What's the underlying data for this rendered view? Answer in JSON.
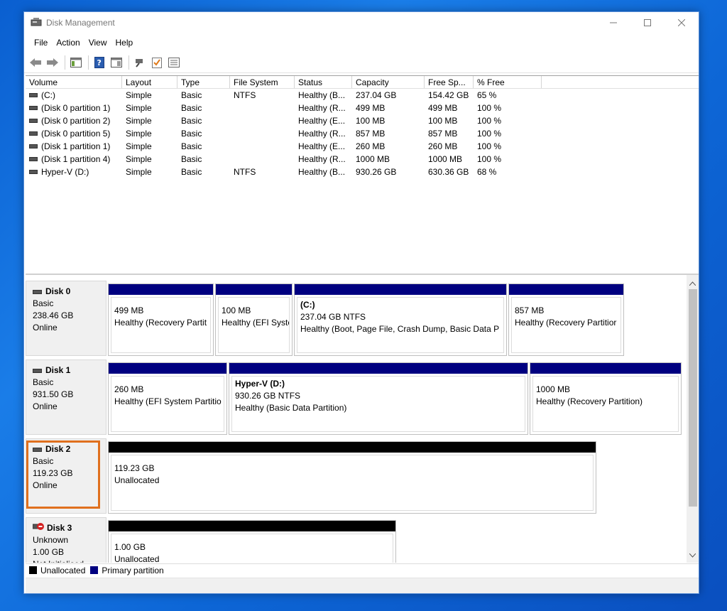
{
  "window": {
    "title": "Disk Management"
  },
  "menu": [
    "File",
    "Action",
    "View",
    "Help"
  ],
  "toolbar": {
    "icons": [
      "back-icon",
      "forward-icon",
      "show-hide-console-tree-icon",
      "help-icon",
      "properties-icon",
      "connect-icon",
      "check-icon",
      "list-icon"
    ]
  },
  "volume_table": {
    "headers": [
      "Volume",
      "Layout",
      "Type",
      "File System",
      "Status",
      "Capacity",
      "Free Sp...",
      "% Free"
    ],
    "rows": [
      [
        "(C:)",
        "Simple",
        "Basic",
        "NTFS",
        "Healthy (B...",
        "237.04 GB",
        "154.42 GB",
        "65 %"
      ],
      [
        "(Disk 0 partition 1)",
        "Simple",
        "Basic",
        "",
        "Healthy (R...",
        "499 MB",
        "499 MB",
        "100 %"
      ],
      [
        "(Disk 0 partition 2)",
        "Simple",
        "Basic",
        "",
        "Healthy (E...",
        "100 MB",
        "100 MB",
        "100 %"
      ],
      [
        "(Disk 0 partition 5)",
        "Simple",
        "Basic",
        "",
        "Healthy (R...",
        "857 MB",
        "857 MB",
        "100 %"
      ],
      [
        "(Disk 1 partition 1)",
        "Simple",
        "Basic",
        "",
        "Healthy (E...",
        "260 MB",
        "260 MB",
        "100 %"
      ],
      [
        "(Disk 1 partition 4)",
        "Simple",
        "Basic",
        "",
        "Healthy (R...",
        "1000 MB",
        "1000 MB",
        "100 %"
      ],
      [
        "Hyper-V (D:)",
        "Simple",
        "Basic",
        "NTFS",
        "Healthy (B...",
        "930.26 GB",
        "630.36 GB",
        "68 %"
      ]
    ]
  },
  "disks": [
    {
      "name": "Disk 0",
      "type": "Basic",
      "size": "238.46 GB",
      "state": "Online",
      "partitions": [
        {
          "name": "",
          "line1": "499 MB",
          "line2": "Healthy (Recovery Partit"
        },
        {
          "name": "",
          "line1": "100 MB",
          "line2": "Healthy (EFI Syste"
        },
        {
          "name": "(C:)",
          "line1": "237.04 GB NTFS",
          "line2": "Healthy (Boot, Page File, Crash Dump, Basic Data P"
        },
        {
          "name": "",
          "line1": "857 MB",
          "line2": "Healthy (Recovery Partitior"
        }
      ]
    },
    {
      "name": "Disk 1",
      "type": "Basic",
      "size": "931.50 GB",
      "state": "Online",
      "partitions": [
        {
          "name": "",
          "line1": "260 MB",
          "line2": "Healthy (EFI System Partitio"
        },
        {
          "name": "Hyper-V  (D:)",
          "line1": "930.26 GB NTFS",
          "line2": "Healthy (Basic Data Partition)"
        },
        {
          "name": "",
          "line1": "1000 MB",
          "line2": "Healthy (Recovery Partition)"
        }
      ]
    },
    {
      "name": "Disk 2",
      "type": "Basic",
      "size": "119.23 GB",
      "state": "Online",
      "partitions": [
        {
          "name": "",
          "line1": "119.23 GB",
          "line2": "Unallocated"
        }
      ]
    },
    {
      "name": "Disk 3",
      "type": "Unknown",
      "size": "1.00 GB",
      "state": "Not Initialised",
      "partitions": [
        {
          "name": "",
          "line1": "1.00 GB",
          "line2": "Unallocated"
        }
      ]
    }
  ],
  "legend": {
    "unallocated": "Unallocated",
    "primary": "Primary partition",
    "unallocated_color": "#000000",
    "primary_color": "#000080"
  },
  "colors": {
    "highlight": "#e0701e",
    "primary_bar": "#000080",
    "unallocated_bar": "#000000"
  }
}
